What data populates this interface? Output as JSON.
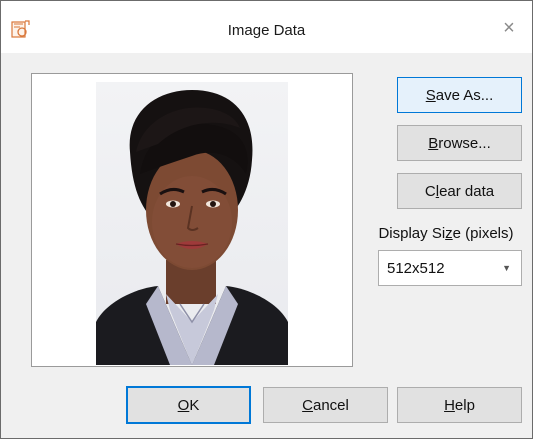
{
  "window": {
    "title": "Image Data",
    "close_label": "×",
    "app_icon": "image-data-icon"
  },
  "preview": {
    "image": "portrait-photo"
  },
  "side_buttons": {
    "save_as_mnemonic": "S",
    "save_as_rest": "ave As...",
    "browse_mnemonic": "B",
    "browse_rest": "rowse...",
    "clear_prefix": "C",
    "clear_mnemonic": "l",
    "clear_rest": "ear data"
  },
  "display_size": {
    "label_prefix": "Display Si",
    "label_mnemonic": "z",
    "label_rest": "e (pixels)",
    "selected": "512x512"
  },
  "footer": {
    "ok_mnemonic": "O",
    "ok_rest": "K",
    "cancel_mnemonic": "C",
    "cancel_rest": "ancel",
    "help_mnemonic": "H",
    "help_rest": "elp"
  },
  "colors": {
    "accent": "#0078d7",
    "dialog_bg": "#f0f0f0",
    "button_bg": "#e1e1e1"
  }
}
